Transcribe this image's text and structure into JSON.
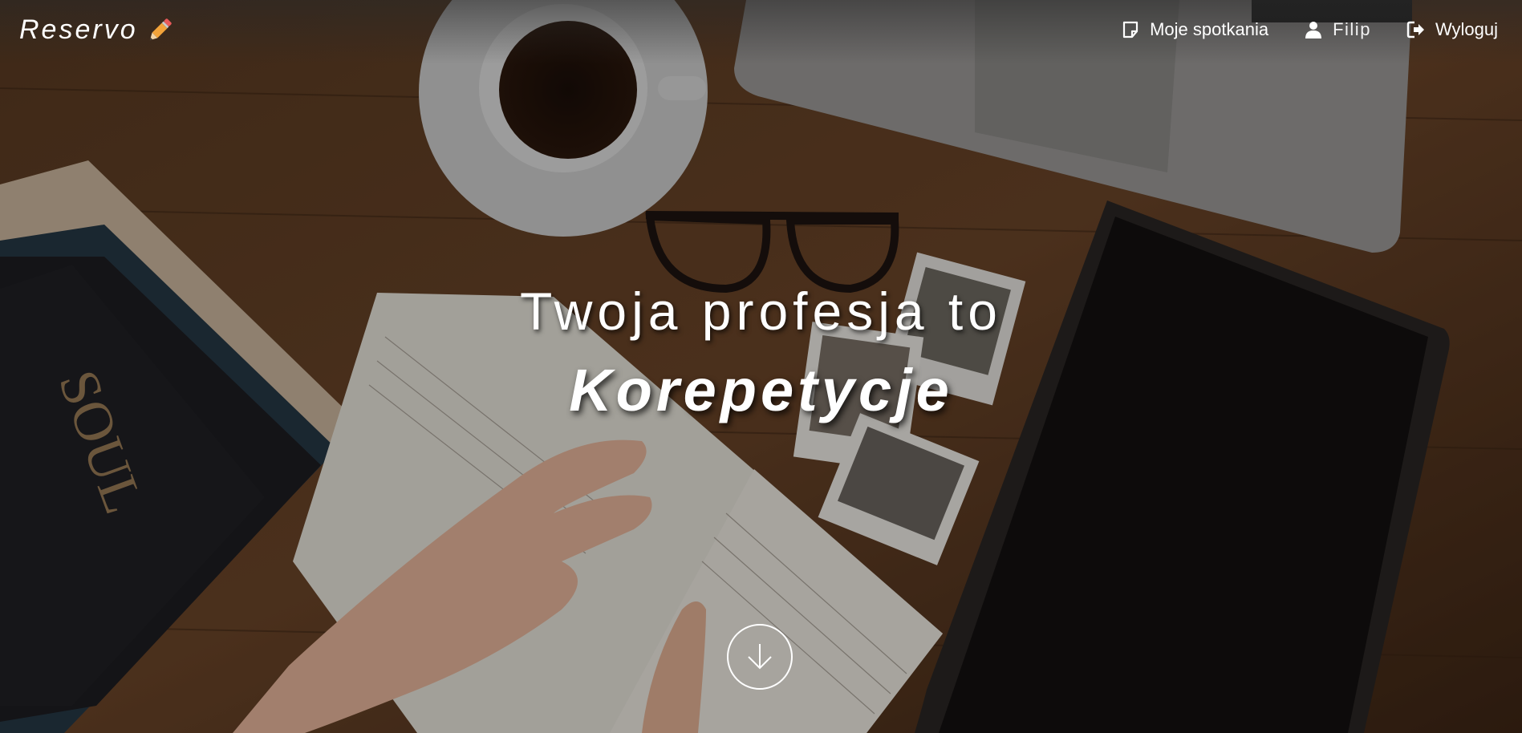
{
  "navbar": {
    "brand": "Reservo",
    "brand_icon": "pencil-icon",
    "links": [
      {
        "label": "Moje spotkania",
        "icon": "note-icon"
      },
      {
        "label": "Filip",
        "icon": "user-icon"
      },
      {
        "label": "Wyloguj",
        "icon": "logout-icon"
      }
    ]
  },
  "hero": {
    "line1": "Twoja profesja to",
    "line2": "Korepetycje",
    "scroll_icon": "arrow-down-icon"
  },
  "colors": {
    "text": "#ffffff",
    "background_wood": "#4a3220"
  }
}
